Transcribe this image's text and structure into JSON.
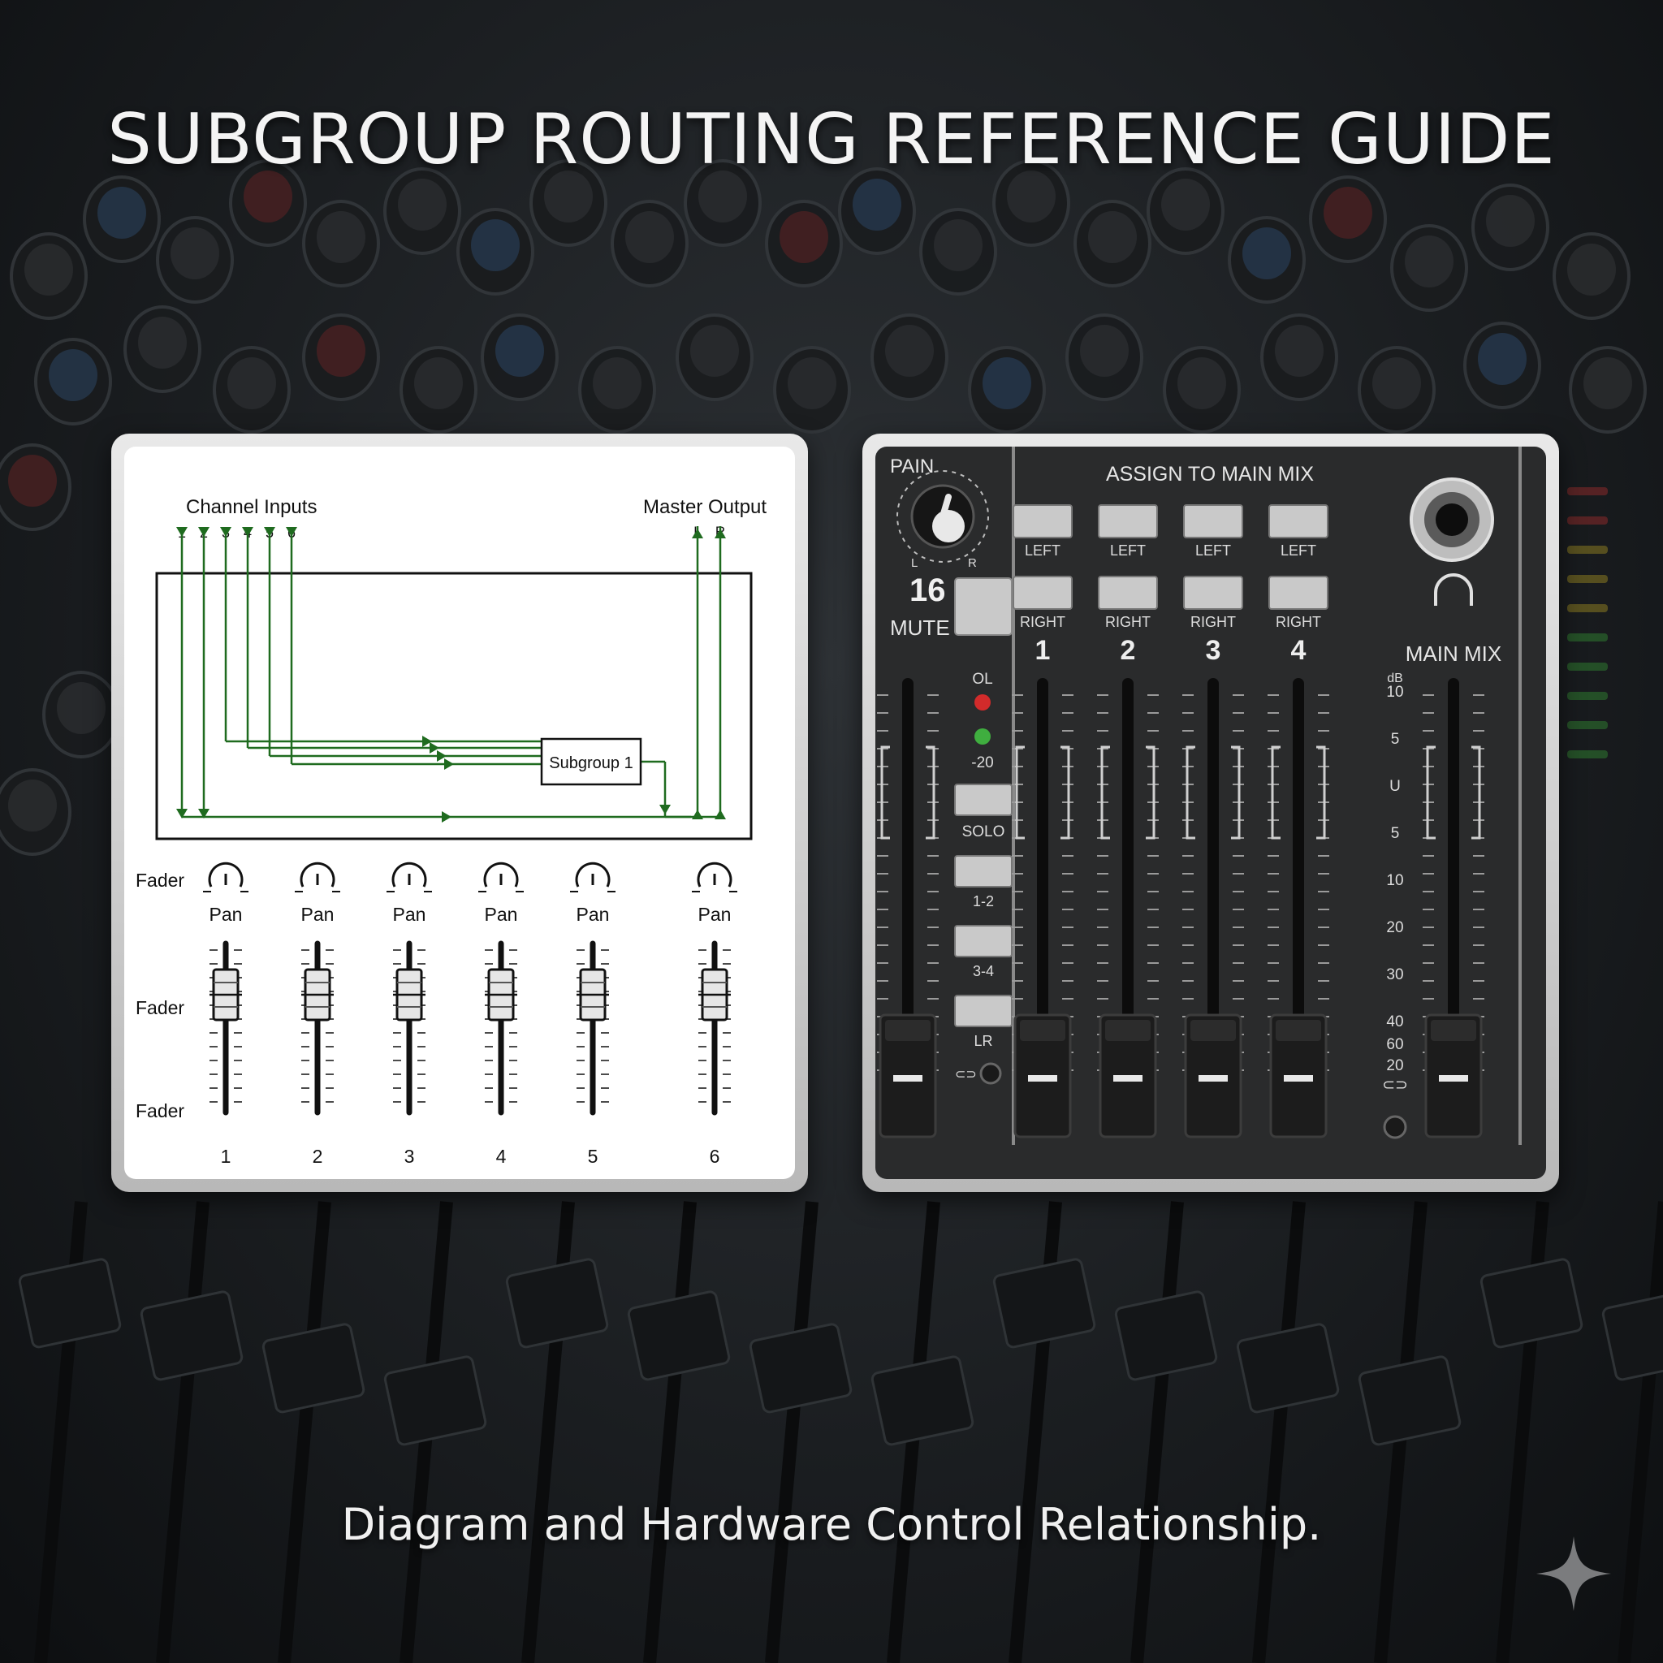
{
  "header": {
    "title": "SUBGROUP ROUTING REFERENCE GUIDE"
  },
  "footer": {
    "caption": "Diagram and Hardware Control Relationship."
  },
  "diagram": {
    "inputs_label": "Channel Inputs",
    "output_label": "Master Output",
    "input_numbers": [
      "1",
      "2",
      "3",
      "4",
      "5",
      "6"
    ],
    "output_left": "L",
    "output_right": "R",
    "subgroup_label": "Subgroup 1",
    "fader_label": "Fader",
    "pan_label": "Pan",
    "channel_numbers": [
      "1",
      "2",
      "3",
      "4",
      "5",
      "6"
    ],
    "line_color": "#1f6b1f"
  },
  "hardware": {
    "pan_label": "PAIN",
    "pan_l": "L",
    "pan_r": "R",
    "channel_number": "16",
    "mute_label": "MUTE",
    "ol_label": "OL",
    "meter_label": "-20",
    "solo_label": "SOLO",
    "assign_12": "1-2",
    "assign_34": "3-4",
    "assign_lr": "LR",
    "link_symbol": "⊂⊃",
    "assign_title": "ASSIGN TO MAIN MIX",
    "left_label": "LEFT",
    "right_label": "RIGHT",
    "group_numbers": [
      "1",
      "2",
      "3",
      "4"
    ],
    "main_mix_label": "MAIN MIX",
    "db_label": "dB",
    "scale": [
      "10",
      "5",
      "U",
      "5",
      "10",
      "20",
      "30",
      "40",
      "60",
      "20",
      "⊂⊃"
    ],
    "led_red": "#d22b2b",
    "led_green": "#3fae3f"
  }
}
